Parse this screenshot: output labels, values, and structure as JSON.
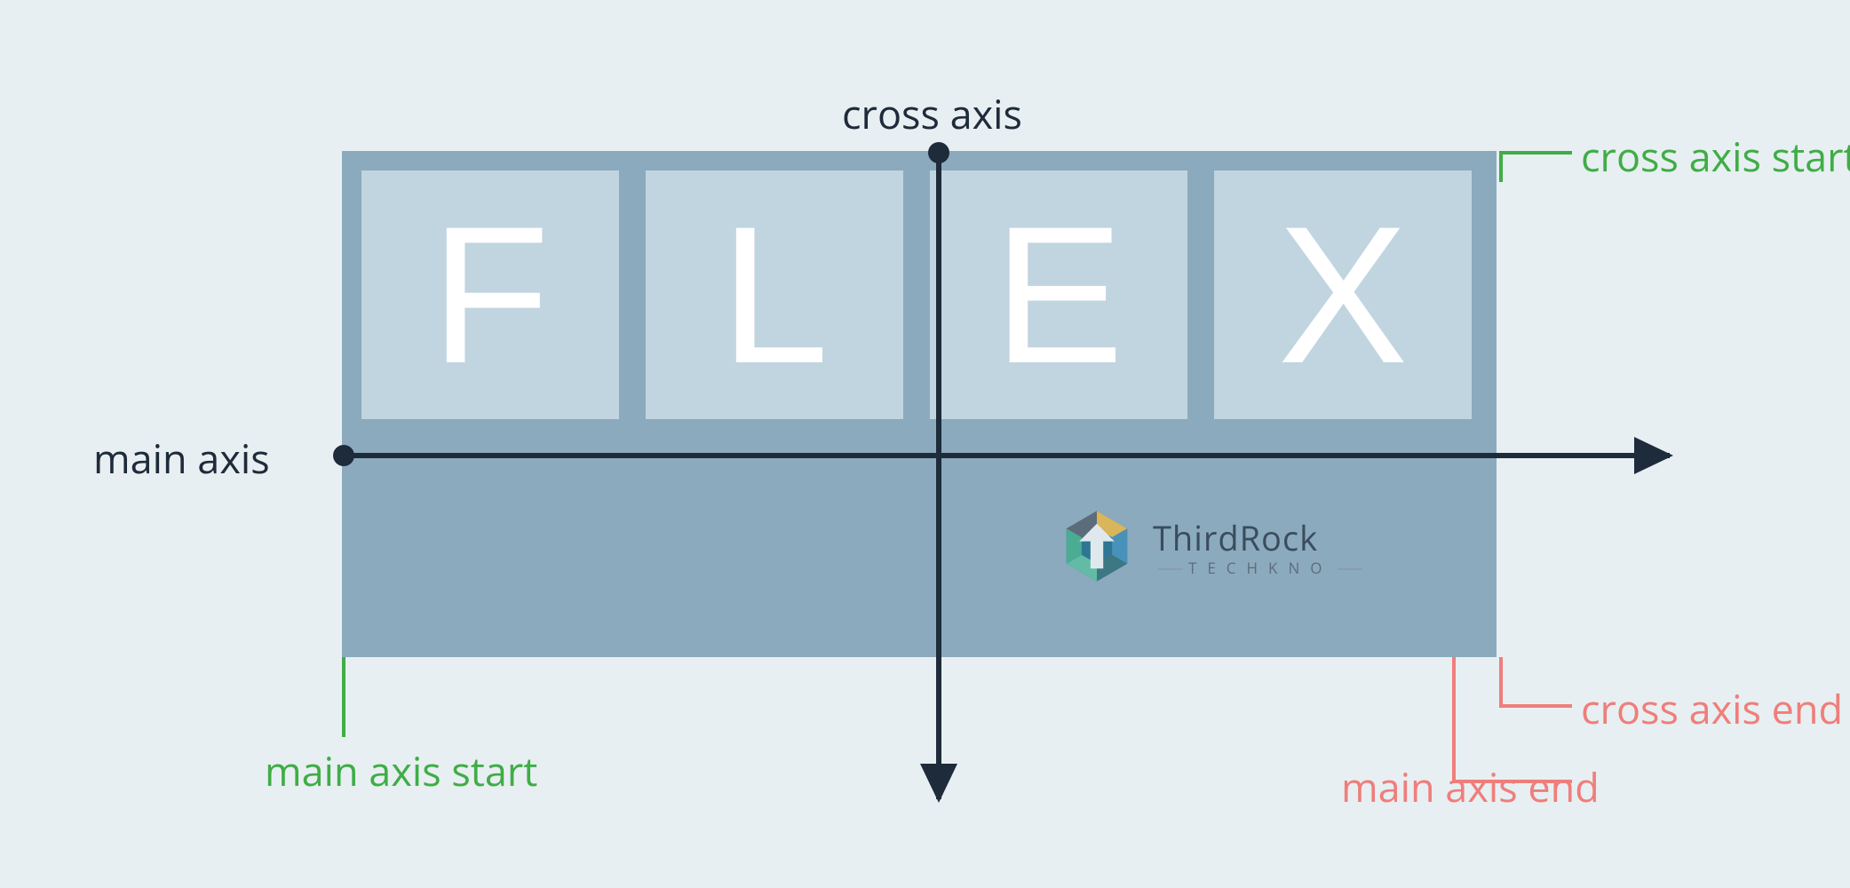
{
  "labels": {
    "cross_axis": "cross axis",
    "main_axis": "main axis",
    "cross_axis_start": "cross axis start",
    "cross_axis_end": "cross axis end",
    "main_axis_start": "main axis start",
    "main_axis_end": "main axis end"
  },
  "flex_items": [
    "F",
    "L",
    "E",
    "X"
  ],
  "logo": {
    "brand": "ThirdRock",
    "subline": "TECHKNO"
  },
  "colors": {
    "background": "#e8eff2",
    "container": "#8baabd",
    "item": "#c1d5e0",
    "axis": "#1e2b3a",
    "start": "#3fad46",
    "end": "#ef7e7b"
  }
}
